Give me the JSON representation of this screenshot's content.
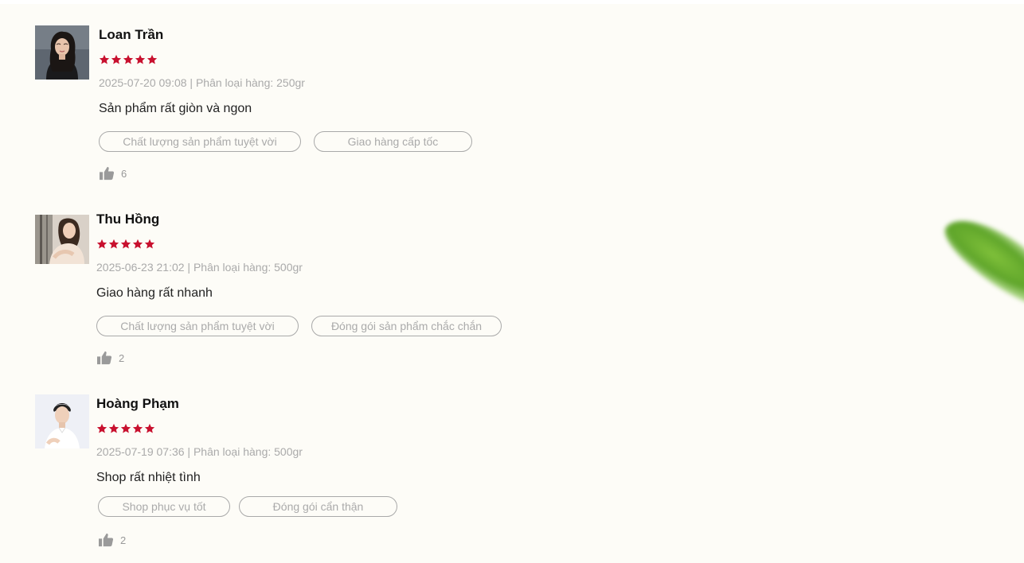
{
  "colors": {
    "background": "#fdfcf7",
    "star": "#c8102e",
    "muted_text": "#aaaaaa",
    "tag_border": "#a9a9a9"
  },
  "reviews": [
    {
      "name": "Loan Trần",
      "rating": 5,
      "meta": "2025-07-20 09:08 | Phân loại hàng: 250gr",
      "comment": "Sản phẩm rất giòn và ngon",
      "tags": [
        "Chất lượng sản phẩm tuyệt vời",
        "Giao hàng cấp tốc"
      ],
      "likes": "6",
      "avatar_icon": "user-avatar-photo"
    },
    {
      "name": "Thu Hồng",
      "rating": 5,
      "meta": "2025-06-23 21:02 | Phân loại hàng: 500gr",
      "comment": "Giao hàng rất nhanh",
      "tags": [
        "Chất lượng sản phẩm tuyệt vời",
        "Đóng gói sản phẩm chắc chắn"
      ],
      "likes": "2",
      "avatar_icon": "user-avatar-photo"
    },
    {
      "name": "Hoàng Phạm",
      "rating": 5,
      "meta": "2025-07-19 07:36 | Phân loại hàng: 500gr",
      "comment": "Shop rất nhiệt tình",
      "tags": [
        "Shop phục vụ tốt",
        "Đóng gói cẩn thận"
      ],
      "likes": "2",
      "avatar_icon": "user-avatar-photo"
    }
  ]
}
